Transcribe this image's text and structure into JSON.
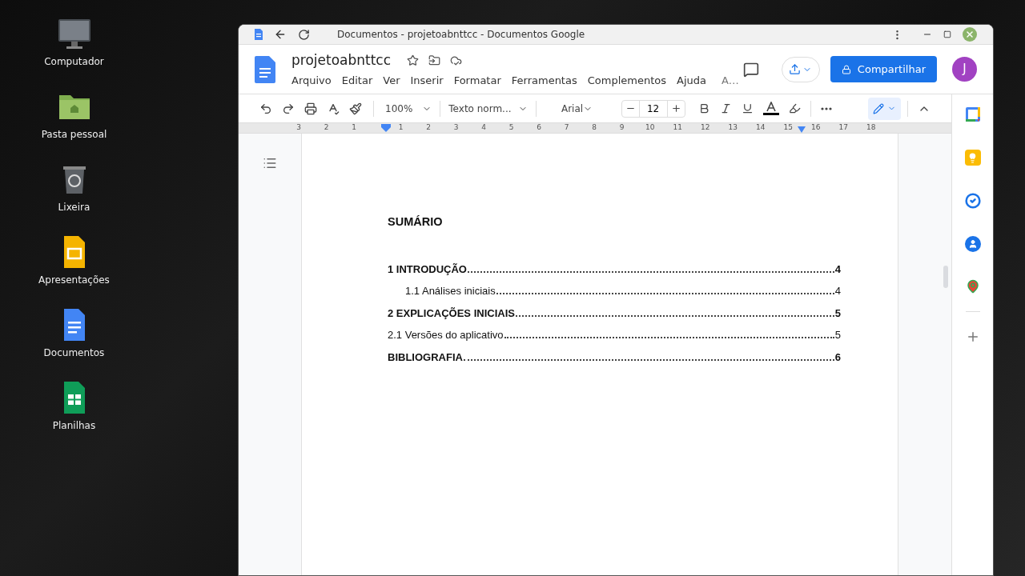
{
  "desktop_icons": [
    {
      "kind": "monitor",
      "label": "Computador"
    },
    {
      "kind": "folder",
      "label": "Pasta pessoal"
    },
    {
      "kind": "trash",
      "label": "Lixeira"
    },
    {
      "kind": "slides",
      "label": "Apresentações"
    },
    {
      "kind": "docs",
      "label": "Documentos"
    },
    {
      "kind": "sheets",
      "label": "Planilhas"
    }
  ],
  "window": {
    "title": "Documentos - projetoabnttcc - Documentos Google"
  },
  "document": {
    "name": "projetoabnttcc",
    "starred": false
  },
  "menu": [
    "Arquivo",
    "Editar",
    "Ver",
    "Inserir",
    "Formatar",
    "Ferramentas",
    "Complementos",
    "Ajuda",
    "A…"
  ],
  "share_button": "Compartilhar",
  "avatar": {
    "letter": "J",
    "color": "#a142c2"
  },
  "toolbar": {
    "zoom": "100%",
    "style": "Texto norm...",
    "font": "Arial",
    "size": "12"
  },
  "ruler": [
    "3",
    "2",
    "1",
    "1",
    "2",
    "3",
    "4",
    "5",
    "6",
    "7",
    "8",
    "9",
    "10",
    "11",
    "12",
    "13",
    "14",
    "15",
    "16",
    "17",
    "18"
  ],
  "page": {
    "heading": "SUMÁRIO",
    "entries": [
      {
        "text": "1 INTRODUÇÃO",
        "page": "4",
        "bold": true,
        "indented": false
      },
      {
        "text": "1.1 Análises iniciais",
        "page": "4",
        "bold": false,
        "indented": true
      },
      {
        "text": "2 EXPLICAÇÕES INICIAIS",
        "page": "5",
        "bold": true,
        "indented": false
      },
      {
        "text": "2.1 Versões do aplicativo",
        "page": "5",
        "bold": false,
        "indented": false
      },
      {
        "text": "BIBLIOGRAFIA",
        "page": "6",
        "bold": true,
        "indented": false
      }
    ]
  },
  "side_panel": [
    {
      "kind": "calendar"
    },
    {
      "kind": "keep"
    },
    {
      "kind": "tasks"
    },
    {
      "kind": "contacts"
    },
    {
      "kind": "maps"
    }
  ]
}
